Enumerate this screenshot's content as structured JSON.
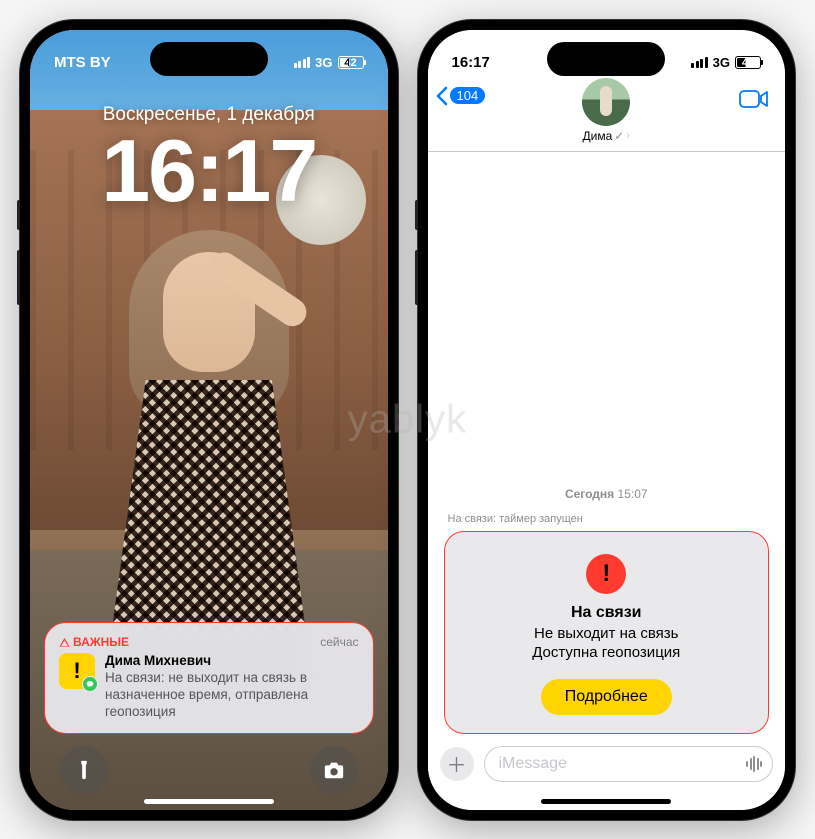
{
  "watermark": "yablyk",
  "left": {
    "carrier": "MTS BY",
    "network": "3G",
    "battery_pct": 42,
    "date": "Воскресенье, 1 декабря",
    "time": "16:17",
    "notification": {
      "important_label": "ВАЖНЫЕ",
      "timestamp": "сейчас",
      "sender": "Дима Михневич",
      "message": "На связи: не выходит на связь в назначенное время, отправлена геопозиция"
    }
  },
  "right": {
    "time": "16:17",
    "network": "3G",
    "battery_pct": 42,
    "back_count": "104",
    "contact_name": "Дима",
    "thread_date_label": "Сегодня",
    "thread_date_time": "15:07",
    "status_line": "На связи: таймер запущен",
    "card": {
      "title": "На связи",
      "line1": "Не выходит на связь",
      "line2": "Доступна геопозиция",
      "button": "Подробнее"
    },
    "input_placeholder": "iMessage"
  }
}
